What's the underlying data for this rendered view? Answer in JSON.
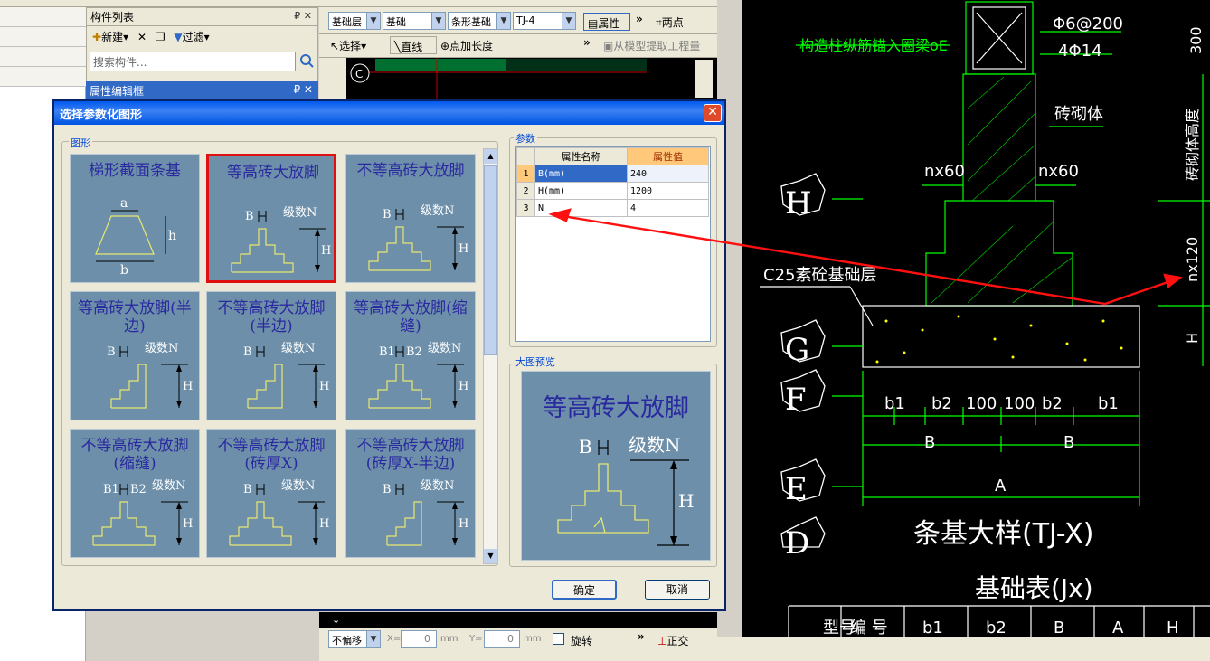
{
  "app": {
    "complist_title": "构件列表",
    "new_btn": "新建",
    "filter_btn": "过滤",
    "search_placeholder": "搜索构件...",
    "prop_editor_title": "属性编辑框"
  },
  "toolbar1": {
    "layer": "基础层",
    "category": "基础",
    "type": "条形基础",
    "item": "TJ-4",
    "attr_btn": "属性",
    "two_points": "两点"
  },
  "toolbar2": {
    "select": "选择",
    "line": "直线",
    "point_len": "点加长度",
    "extract": "从模型提取工程量"
  },
  "bottombar": {
    "offset": "不偏移",
    "x_label": "X=",
    "x_val": "0",
    "y_label": "Y=",
    "y_val": "0",
    "unit": "mm",
    "rotate": "旋转",
    "ortho": "正交"
  },
  "dialog": {
    "title": "选择参数化图形",
    "shapes_group": "图形",
    "params_group": "参数",
    "preview_group": "大图预览",
    "ok": "确定",
    "cancel": "取消",
    "tiles": [
      {
        "label": "梯形截面条基"
      },
      {
        "label": "等高砖大放脚"
      },
      {
        "label": "不等高砖大放脚"
      },
      {
        "label": "等高砖大放脚(半边)"
      },
      {
        "label": "不等高砖大放脚(半边)"
      },
      {
        "label": "等高砖大放脚(缩缝)"
      },
      {
        "label": "不等高砖大放脚(缩缝)"
      },
      {
        "label": "不等高砖大放脚(砖厚X)"
      },
      {
        "label": "不等高砖大放脚(砖厚X-半边)"
      }
    ],
    "params": {
      "col_name": "属性名称",
      "col_value": "属性值",
      "rows": [
        {
          "idx": "1",
          "name": "B(mm)",
          "value": "240"
        },
        {
          "idx": "2",
          "name": "H(mm)",
          "value": "1200"
        },
        {
          "idx": "3",
          "name": "N",
          "value": "4"
        }
      ]
    },
    "preview_label": "等高砖大放脚",
    "diagram_labels": {
      "a": "a",
      "b": "b",
      "h": "h",
      "B": "B",
      "H": "H",
      "N": "级数N",
      "B1": "B1",
      "B2": "B2"
    }
  },
  "cad": {
    "labels": [
      "Φ6@200",
      "4Φ14",
      "构造柱纵筋锚入圈梁oE",
      "砖砌体",
      "nx60",
      "nx60",
      "C25素砼基础层",
      "300",
      "砖砌体高度",
      "nx120",
      "H",
      "b1",
      "b2",
      "100",
      "100",
      "b2",
      "b1",
      "B",
      "B",
      "A",
      "条基大样(TJ-X)",
      "基础表(Jx)",
      "型号",
      "编 号",
      "b1",
      "b2",
      "B",
      "A",
      "H"
    ],
    "axes": [
      "H",
      "G",
      "F",
      "E",
      "D"
    ]
  },
  "colors": {
    "accent": "#3169c6",
    "cad_green": "#00ff00",
    "selection_red": "#e01010"
  }
}
